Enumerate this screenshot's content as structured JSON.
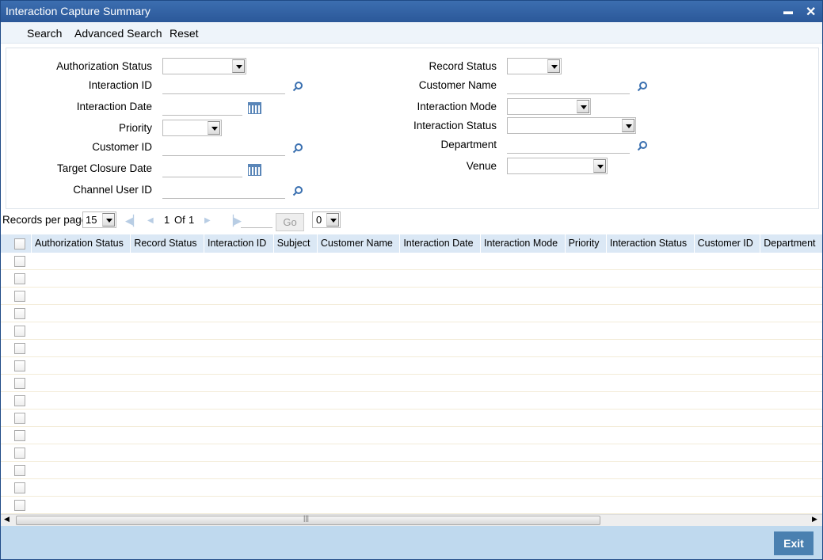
{
  "window": {
    "title": "Interaction Capture Summary",
    "minimize": "▬",
    "close": "✕"
  },
  "toolbar": {
    "search": "Search",
    "advanced_search": "Advanced Search",
    "reset": "Reset"
  },
  "form": {
    "left": [
      {
        "label": "Authorization Status",
        "type": "select",
        "value": ""
      },
      {
        "label": "Interaction ID",
        "type": "search",
        "value": ""
      },
      {
        "label": "Interaction Date",
        "type": "date",
        "value": ""
      },
      {
        "label": "Priority",
        "type": "select",
        "value": ""
      },
      {
        "label": "Customer ID",
        "type": "search",
        "value": ""
      },
      {
        "label": "Target Closure Date",
        "type": "date",
        "value": ""
      },
      {
        "label": "Channel User ID",
        "type": "search",
        "value": ""
      }
    ],
    "right": [
      {
        "label": "Record Status",
        "type": "select",
        "value": ""
      },
      {
        "label": "Customer Name",
        "type": "search",
        "value": ""
      },
      {
        "label": "Interaction Mode",
        "type": "select",
        "value": ""
      },
      {
        "label": "Interaction Status",
        "type": "select",
        "value": ""
      },
      {
        "label": "Department",
        "type": "search",
        "value": ""
      },
      {
        "label": "Venue",
        "type": "select",
        "value": ""
      }
    ]
  },
  "pager": {
    "records_per_page_label": "Records per page",
    "records_per_page": "15",
    "page": "1",
    "of_label": "Of",
    "total_pages": "1",
    "go": "Go",
    "goto_value": "",
    "select_value": "0"
  },
  "table": {
    "columns": [
      "Authorization Status",
      "Record Status",
      "Interaction ID",
      "Subject",
      "Customer Name",
      "Interaction Date",
      "Interaction Mode",
      "Priority",
      "Interaction Status",
      "Customer ID",
      "Department"
    ],
    "row_count": 15
  },
  "footer": {
    "exit": "Exit"
  },
  "colors": {
    "title_bar": "#2b5899",
    "header_row": "#dbe8f5",
    "footer": "#bfd9ee",
    "exit_button": "#4a80b0"
  }
}
